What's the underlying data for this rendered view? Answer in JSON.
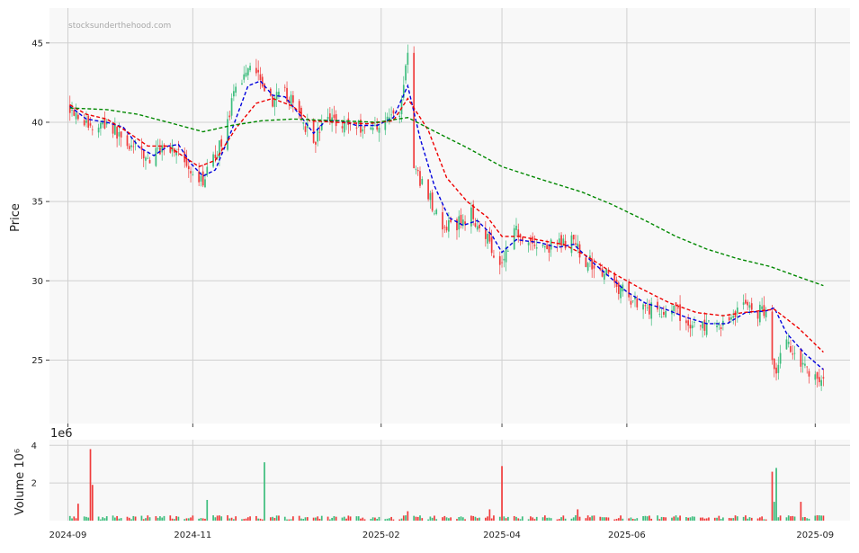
{
  "watermark": "stocksunderthehood.com",
  "colors": {
    "up": "#3dbd7d",
    "down": "#f03c3c",
    "ma_short": "#0000dd",
    "ma_mid": "#ee0000",
    "ma_long": "#008800",
    "panel_bg": "#f8f8f8",
    "grid": "#d0d0d0"
  },
  "chart_data": [
    {
      "type": "candlestick",
      "ylabel": "Price",
      "ylim": [
        21,
        47.2
      ],
      "yticks": [
        25,
        30,
        35,
        40,
        45
      ],
      "xlim": [
        "2024-08-23",
        "2025-09-18"
      ],
      "xticks": [
        "2024-09",
        "2024-11",
        "2025-02",
        "2025-04",
        "2025-06",
        "2025-09"
      ],
      "xtick_dates": [
        "2024-09-01",
        "2024-11-01",
        "2025-02-01",
        "2025-04-01",
        "2025-06-01",
        "2025-09-01"
      ],
      "grid": true,
      "close_anchors": [
        [
          "2024-09-02",
          41.0
        ],
        [
          "2024-09-06",
          40.5
        ],
        [
          "2024-09-12",
          39.6
        ],
        [
          "2024-09-20",
          40.0
        ],
        [
          "2024-09-27",
          39.0
        ],
        [
          "2024-10-04",
          38.3
        ],
        [
          "2024-10-11",
          37.6
        ],
        [
          "2024-10-18",
          38.6
        ],
        [
          "2024-10-25",
          38.2
        ],
        [
          "2024-10-31",
          36.4
        ],
        [
          "2024-11-05",
          36.2
        ],
        [
          "2024-11-10",
          37.3
        ],
        [
          "2024-11-15",
          38.8
        ],
        [
          "2024-11-22",
          42.0
        ],
        [
          "2024-11-29",
          43.8
        ],
        [
          "2024-12-04",
          43.0
        ],
        [
          "2024-12-09",
          41.3
        ],
        [
          "2024-12-16",
          41.8
        ],
        [
          "2024-12-23",
          40.6
        ],
        [
          "2024-12-30",
          38.8
        ],
        [
          "2025-01-06",
          40.3
        ],
        [
          "2025-01-13",
          40.0
        ],
        [
          "2025-01-20",
          39.8
        ],
        [
          "2025-01-27",
          39.6
        ],
        [
          "2025-02-03",
          40.2
        ],
        [
          "2025-02-10",
          40.6
        ],
        [
          "2025-02-14",
          44.5
        ],
        [
          "2025-02-17",
          37.0
        ],
        [
          "2025-02-24",
          35.5
        ],
        [
          "2025-03-03",
          33.2
        ],
        [
          "2025-03-10",
          33.6
        ],
        [
          "2025-03-17",
          34.2
        ],
        [
          "2025-03-24",
          33.0
        ],
        [
          "2025-03-31",
          31.0
        ],
        [
          "2025-04-07",
          33.3
        ],
        [
          "2025-04-14",
          32.5
        ],
        [
          "2025-04-21",
          32.0
        ],
        [
          "2025-04-28",
          32.3
        ],
        [
          "2025-05-05",
          32.5
        ],
        [
          "2025-05-12",
          31.3
        ],
        [
          "2025-05-19",
          30.8
        ],
        [
          "2025-05-26",
          29.8
        ],
        [
          "2025-06-02",
          29.0
        ],
        [
          "2025-06-09",
          28.5
        ],
        [
          "2025-06-16",
          28.0
        ],
        [
          "2025-06-23",
          28.3
        ],
        [
          "2025-06-30",
          27.3
        ],
        [
          "2025-07-07",
          27.2
        ],
        [
          "2025-07-14",
          27.0
        ],
        [
          "2025-07-21",
          27.6
        ],
        [
          "2025-07-28",
          28.6
        ],
        [
          "2025-08-04",
          28.0
        ],
        [
          "2025-08-08",
          28.3
        ],
        [
          "2025-08-12",
          24.2
        ],
        [
          "2025-08-18",
          26.2
        ],
        [
          "2025-08-25",
          25.0
        ],
        [
          "2025-09-01",
          23.8
        ],
        [
          "2025-09-05",
          23.8
        ]
      ],
      "series": [
        {
          "key": "ma_short",
          "style": "dashed",
          "values": [
            [
              "2024-09-02",
              41.0
            ],
            [
              "2024-09-10",
              40.2
            ],
            [
              "2024-09-20",
              40.0
            ],
            [
              "2024-09-28",
              39.7
            ],
            [
              "2024-10-06",
              38.4
            ],
            [
              "2024-10-13",
              37.9
            ],
            [
              "2024-10-20",
              38.5
            ],
            [
              "2024-10-25",
              38.6
            ],
            [
              "2024-10-31",
              37.4
            ],
            [
              "2024-11-06",
              36.6
            ],
            [
              "2024-11-12",
              37.0
            ],
            [
              "2024-11-20",
              39.5
            ],
            [
              "2024-11-28",
              42.3
            ],
            [
              "2024-12-04",
              42.6
            ],
            [
              "2024-12-10",
              41.7
            ],
            [
              "2024-12-16",
              41.6
            ],
            [
              "2024-12-23",
              40.5
            ],
            [
              "2024-12-30",
              39.3
            ],
            [
              "2025-01-05",
              40.1
            ],
            [
              "2025-01-12",
              40.1
            ],
            [
              "2025-01-20",
              39.8
            ],
            [
              "2025-01-30",
              39.8
            ],
            [
              "2025-02-07",
              40.3
            ],
            [
              "2025-02-14",
              42.3
            ],
            [
              "2025-02-20",
              39.0
            ],
            [
              "2025-02-27",
              36.0
            ],
            [
              "2025-03-06",
              34.0
            ],
            [
              "2025-03-13",
              33.5
            ],
            [
              "2025-03-20",
              33.8
            ],
            [
              "2025-03-27",
              32.9
            ],
            [
              "2025-04-01",
              31.8
            ],
            [
              "2025-04-08",
              32.6
            ],
            [
              "2025-04-20",
              32.4
            ],
            [
              "2025-04-28",
              32.1
            ],
            [
              "2025-05-06",
              32.3
            ],
            [
              "2025-05-15",
              31.2
            ],
            [
              "2025-05-24",
              30.2
            ],
            [
              "2025-06-01",
              29.3
            ],
            [
              "2025-06-10",
              28.6
            ],
            [
              "2025-06-20",
              28.2
            ],
            [
              "2025-06-30",
              27.7
            ],
            [
              "2025-07-10",
              27.3
            ],
            [
              "2025-07-20",
              27.3
            ],
            [
              "2025-07-29",
              28.0
            ],
            [
              "2025-08-08",
              28.1
            ],
            [
              "2025-08-12",
              28.3
            ],
            [
              "2025-08-18",
              26.7
            ],
            [
              "2025-08-27",
              25.4
            ],
            [
              "2025-09-05",
              24.4
            ]
          ]
        },
        {
          "key": "ma_mid",
          "style": "dashed",
          "values": [
            [
              "2024-09-02",
              41.1
            ],
            [
              "2024-09-10",
              40.5
            ],
            [
              "2024-09-20",
              40.2
            ],
            [
              "2024-09-30",
              39.4
            ],
            [
              "2024-10-10",
              38.5
            ],
            [
              "2024-10-20",
              38.5
            ],
            [
              "2024-10-28",
              37.8
            ],
            [
              "2024-11-04",
              37.2
            ],
            [
              "2024-11-12",
              37.6
            ],
            [
              "2024-11-22",
              39.6
            ],
            [
              "2024-12-02",
              41.2
            ],
            [
              "2024-12-10",
              41.5
            ],
            [
              "2024-12-20",
              41.0
            ],
            [
              "2024-12-28",
              40.1
            ],
            [
              "2025-01-10",
              40.0
            ],
            [
              "2025-01-25",
              39.9
            ],
            [
              "2025-02-07",
              40.1
            ],
            [
              "2025-02-14",
              41.5
            ],
            [
              "2025-02-24",
              39.5
            ],
            [
              "2025-03-05",
              36.5
            ],
            [
              "2025-03-15",
              35.0
            ],
            [
              "2025-03-25",
              34.0
            ],
            [
              "2025-04-01",
              32.8
            ],
            [
              "2025-04-10",
              32.8
            ],
            [
              "2025-04-22",
              32.5
            ],
            [
              "2025-05-01",
              32.3
            ],
            [
              "2025-05-12",
              31.6
            ],
            [
              "2025-05-25",
              30.5
            ],
            [
              "2025-06-08",
              29.5
            ],
            [
              "2025-06-22",
              28.6
            ],
            [
              "2025-07-05",
              28.0
            ],
            [
              "2025-07-18",
              27.8
            ],
            [
              "2025-07-28",
              28.0
            ],
            [
              "2025-08-12",
              28.2
            ],
            [
              "2025-08-24",
              27.0
            ],
            [
              "2025-09-05",
              25.5
            ]
          ]
        },
        {
          "key": "ma_long",
          "style": "dashed",
          "values": [
            [
              "2024-09-02",
              40.9
            ],
            [
              "2024-09-20",
              40.8
            ],
            [
              "2024-10-05",
              40.5
            ],
            [
              "2024-10-20",
              40.0
            ],
            [
              "2024-11-06",
              39.4
            ],
            [
              "2024-11-20",
              39.8
            ],
            [
              "2024-12-05",
              40.1
            ],
            [
              "2024-12-20",
              40.2
            ],
            [
              "2025-01-10",
              40.1
            ],
            [
              "2025-01-30",
              40.0
            ],
            [
              "2025-02-14",
              40.3
            ],
            [
              "2025-03-01",
              39.3
            ],
            [
              "2025-03-15",
              38.4
            ],
            [
              "2025-04-01",
              37.2
            ],
            [
              "2025-04-20",
              36.4
            ],
            [
              "2025-05-10",
              35.6
            ],
            [
              "2025-05-25",
              34.8
            ],
            [
              "2025-06-10",
              33.8
            ],
            [
              "2025-06-25",
              32.8
            ],
            [
              "2025-07-10",
              32.0
            ],
            [
              "2025-07-25",
              31.4
            ],
            [
              "2025-08-10",
              30.9
            ],
            [
              "2025-08-25",
              30.2
            ],
            [
              "2025-09-05",
              29.7
            ]
          ]
        }
      ]
    },
    {
      "type": "bar",
      "ylabel": "Volume  10⁶",
      "offset_text": "1e6",
      "ylim": [
        0,
        4.3
      ],
      "yticks": [
        2,
        4
      ],
      "units": "millions of shares",
      "xlim": [
        "2024-08-23",
        "2025-09-18"
      ],
      "grid": true,
      "base_level": 0.16,
      "spikes": [
        [
          "2024-09-06",
          0.9,
          "down"
        ],
        [
          "2024-09-12",
          3.8,
          "down"
        ],
        [
          "2024-09-13",
          1.9,
          "down"
        ],
        [
          "2024-11-08",
          1.1,
          "up"
        ],
        [
          "2024-12-06",
          3.1,
          "up"
        ],
        [
          "2025-02-14",
          0.5,
          "down"
        ],
        [
          "2025-03-26",
          0.6,
          "down"
        ],
        [
          "2025-04-01",
          2.9,
          "down"
        ],
        [
          "2025-05-08",
          0.6,
          "down"
        ],
        [
          "2025-08-11",
          2.6,
          "down"
        ],
        [
          "2025-08-12",
          1.0,
          "up"
        ],
        [
          "2025-08-13",
          2.8,
          "up"
        ],
        [
          "2025-08-25",
          1.0,
          "down"
        ]
      ]
    }
  ]
}
